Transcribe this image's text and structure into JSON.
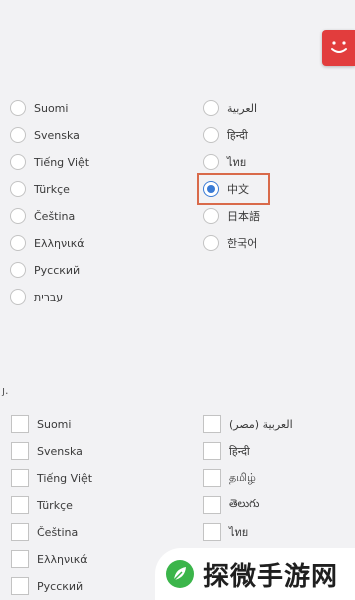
{
  "interface_languages": {
    "left": [
      "Suomi",
      "Svenska",
      "Tiếng Việt",
      "Türkçe",
      "Čeština",
      "Ελληνικά",
      "Русский",
      "עברית"
    ],
    "right": [
      "العربية",
      "हिन्दी",
      "ไทย",
      "中文",
      "日本語",
      "한국어"
    ],
    "selected": "中文"
  },
  "section_marker": "ȷ.",
  "content_languages": {
    "left": [
      "Suomi",
      "Svenska",
      "Tiếng Việt",
      "Türkçe",
      "Čeština",
      "Ελληνικά",
      "Русский"
    ],
    "right": [
      "العربية (مصر)",
      "हिन्दी",
      "தமிழ்",
      "తెలుగు",
      "ไทย"
    ]
  },
  "watermark": {
    "text": "探微手游网"
  },
  "colors": {
    "accent": "#3a7bd5",
    "highlight_border": "#d96a4a",
    "app_badge": "#e23d3d",
    "watermark_leaf": "#3bb54a"
  },
  "icons": {
    "app_badge": "smiley-icon",
    "watermark_logo": "leaf-icon"
  }
}
